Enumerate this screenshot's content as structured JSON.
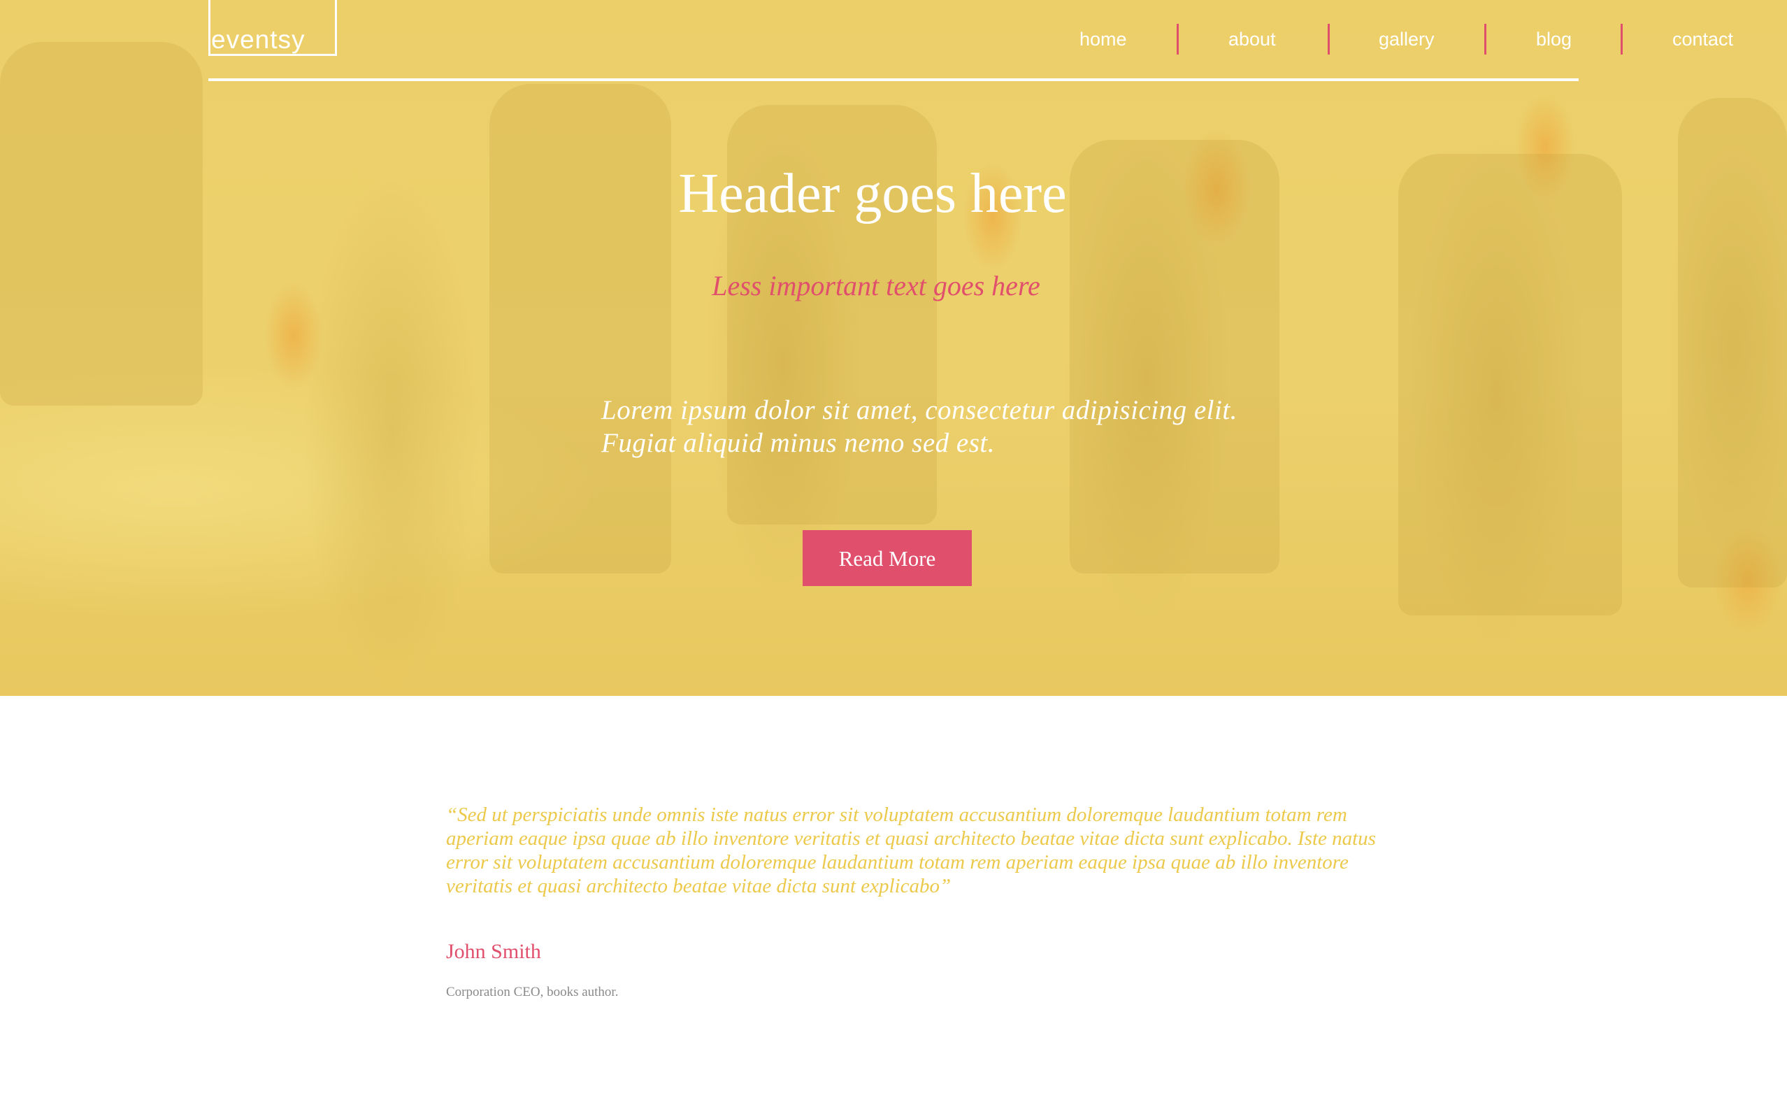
{
  "brand": {
    "logo": "eventsy"
  },
  "nav": {
    "items": [
      {
        "label": "home"
      },
      {
        "label": "about"
      },
      {
        "label": "gallery"
      },
      {
        "label": "blog"
      },
      {
        "label": "contact"
      }
    ]
  },
  "hero": {
    "title": "Header goes here",
    "subtitle": "Less important text goes here",
    "body_line1": "Lorem ipsum dolor sit amet, consectetur adipisicing elit.",
    "body_line2": "Fugiat aliquid minus nemo sed est.",
    "button_label": "Read More"
  },
  "testimonial": {
    "quote": "“Sed ut perspiciatis unde omnis iste natus error sit voluptatem accusantium doloremque laudantium totam rem aperiam eaque ipsa quae ab illo inventore veritatis et quasi architecto beatae vitae dicta sunt explicabo. Iste natus error sit voluptatem accusantium doloremque laudantium totam rem aperiam eaque ipsa quae ab illo inventore veritatis et quasi architecto beatae vitae dicta sunt explicabo”",
    "author": "John Smith",
    "role": "Corporation CEO, books author."
  },
  "colors": {
    "accent": "#e04f6c",
    "hero_overlay": "#ecd06a",
    "quote_text": "#ecc94a",
    "white": "#ffffff"
  }
}
